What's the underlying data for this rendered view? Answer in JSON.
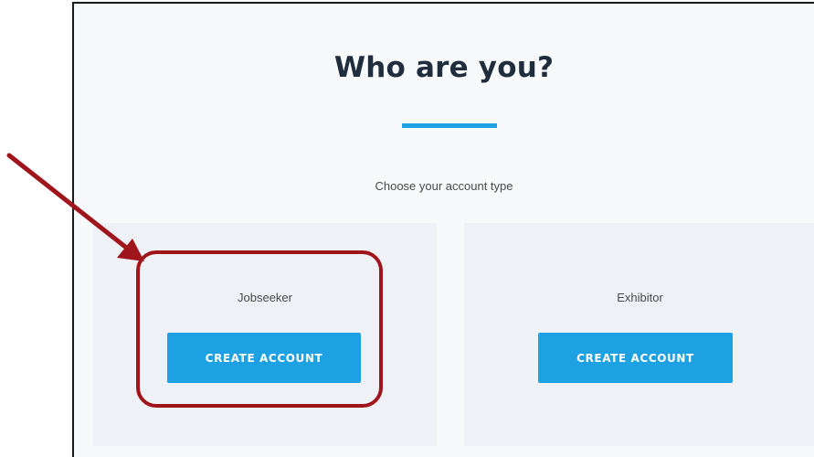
{
  "page": {
    "title": "Who are you?",
    "subtitle": "Choose your account type"
  },
  "accent_color": "#1ea1e2",
  "annotation_color": "#a0151c",
  "cards": [
    {
      "label": "Jobseeker",
      "button_label": "CREATE ACCOUNT"
    },
    {
      "label": "Exhibitor",
      "button_label": "CREATE ACCOUNT"
    }
  ]
}
